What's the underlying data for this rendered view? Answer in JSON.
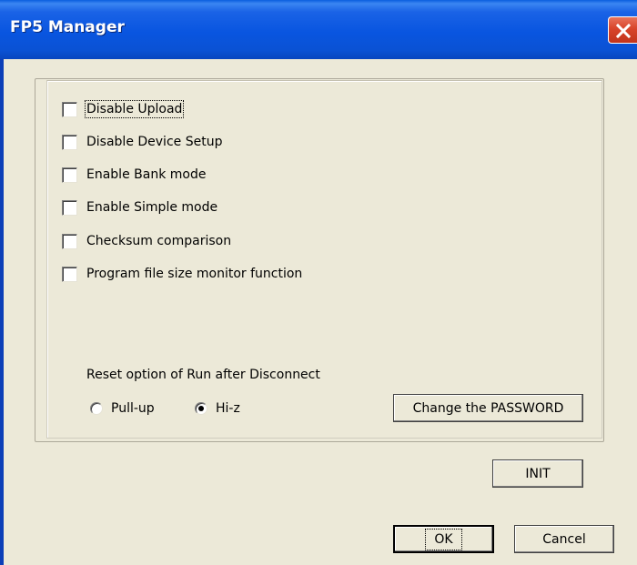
{
  "window": {
    "title": "FP5 Manager",
    "close_icon": "close-icon"
  },
  "options": {
    "checkboxes": [
      {
        "label": "Disable Upload",
        "checked": false
      },
      {
        "label": "Disable Device Setup",
        "checked": false
      },
      {
        "label": "Enable Bank mode",
        "checked": false
      },
      {
        "label": "Enable Simple mode",
        "checked": false
      },
      {
        "label": "Checksum comparison",
        "checked": false
      },
      {
        "label": "Program file size monitor function",
        "checked": false
      }
    ],
    "reset_label": "Reset option of Run after Disconnect",
    "radios": [
      {
        "label": "Pull-up",
        "selected": false
      },
      {
        "label": "Hi-z",
        "selected": true
      }
    ],
    "change_password_label": "Change the PASSWORD"
  },
  "buttons": {
    "init_label": "INIT",
    "ok_label": "OK",
    "cancel_label": "Cancel"
  },
  "colors": {
    "titlebar": "#0a52d4",
    "dialog_bg": "#ece9d8",
    "close_button": "#d8442a"
  }
}
